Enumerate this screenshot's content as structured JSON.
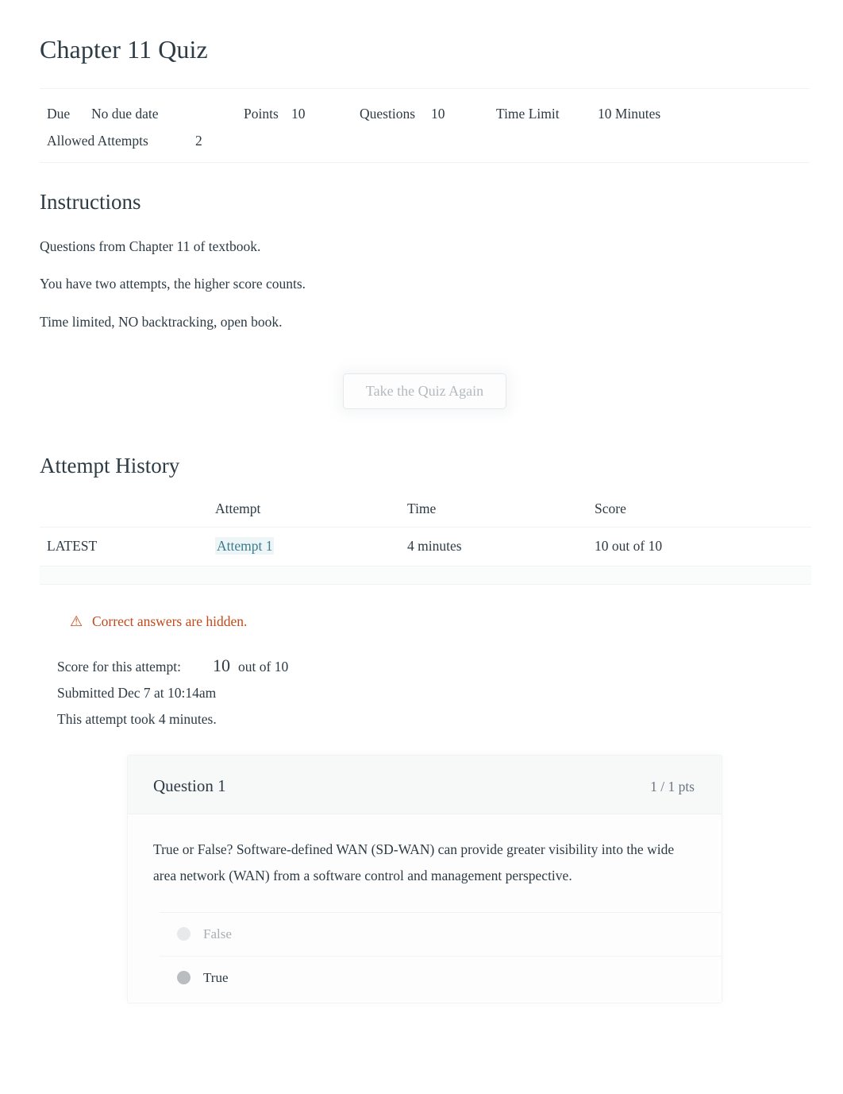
{
  "quiz": {
    "title": "Chapter 11 Quiz",
    "meta": {
      "due_label": "Due",
      "due_value": "No due date",
      "points_label": "Points",
      "points_value": "10",
      "questions_label": "Questions",
      "questions_value": "10",
      "time_limit_label": "Time Limit",
      "time_limit_value": "10 Minutes",
      "allowed_attempts_label": "Allowed Attempts",
      "allowed_attempts_value": "2"
    }
  },
  "instructions": {
    "heading": "Instructions",
    "paragraphs": [
      "Questions from Chapter 11 of textbook.",
      "You have two attempts, the higher score counts.",
      "Time limited, NO backtracking, open book."
    ]
  },
  "actions": {
    "take_quiz_again": "Take the Quiz Again"
  },
  "attempt_history": {
    "heading": "Attempt History",
    "columns": {
      "kept": "",
      "attempt": "Attempt",
      "time": "Time",
      "score": "Score"
    },
    "rows": [
      {
        "kept": "LATEST",
        "attempt": "Attempt 1",
        "time": "4 minutes",
        "score": "10 out of 10"
      }
    ]
  },
  "notice": {
    "icon": "warning-icon",
    "text": "Correct answers are hidden."
  },
  "attempt_summary": {
    "score_label": "Score for this attempt:",
    "score_value": "10",
    "score_suffix": "out of 10",
    "submitted": "Submitted Dec 7 at 10:14am",
    "duration": "This attempt took 4 minutes."
  },
  "questions": [
    {
      "title": "Question 1",
      "points": "1 / 1 pts",
      "text": "True or False? Software-defined WAN (SD-WAN) can provide greater visibility into the wide area network (WAN) from a software control and management perspective.",
      "answers": [
        {
          "label": "False",
          "selected": false
        },
        {
          "label": "True",
          "selected": true
        }
      ]
    }
  ]
}
